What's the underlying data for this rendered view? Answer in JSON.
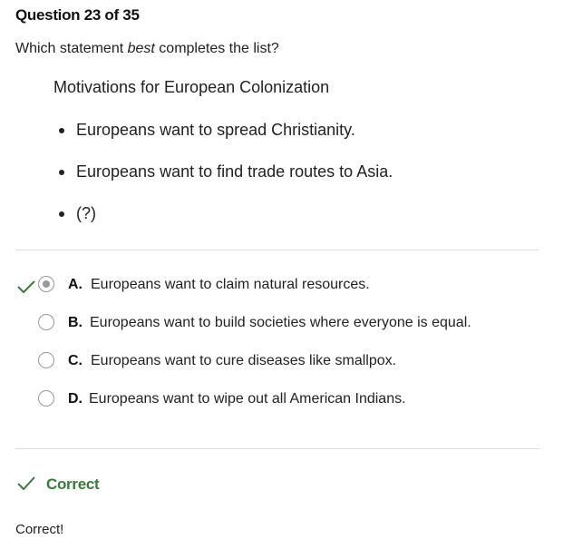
{
  "header": {
    "question_counter": "Question 23 of 35"
  },
  "prompt": {
    "before": "Which statement ",
    "emphasis": "best",
    "after": " completes the list?"
  },
  "list": {
    "title": "Motivations for European Colonization",
    "items": [
      "Europeans want to spread Christianity.",
      "Europeans want to find trade routes to Asia.",
      "(?)"
    ]
  },
  "options": [
    {
      "letter": "A.",
      "text": "Europeans want to claim natural resources.",
      "selected": true,
      "marked_correct": true
    },
    {
      "letter": "B.",
      "text": "Europeans want to build societies where everyone is equal.",
      "selected": false
    },
    {
      "letter": "C.",
      "text": "Europeans want to cure diseases like smallpox.",
      "selected": false
    },
    {
      "letter": "D.",
      "text": "Europeans want to wipe out all American Indians.",
      "selected": false
    }
  ],
  "result": {
    "label": "Correct",
    "icon": "checkmark-icon",
    "color": "#3a7a3a"
  },
  "feedback": {
    "text": "Correct!"
  },
  "colors": {
    "correct_green": "#3a7a3a",
    "radio_gray": "#999999",
    "divider": "#dddddd"
  }
}
